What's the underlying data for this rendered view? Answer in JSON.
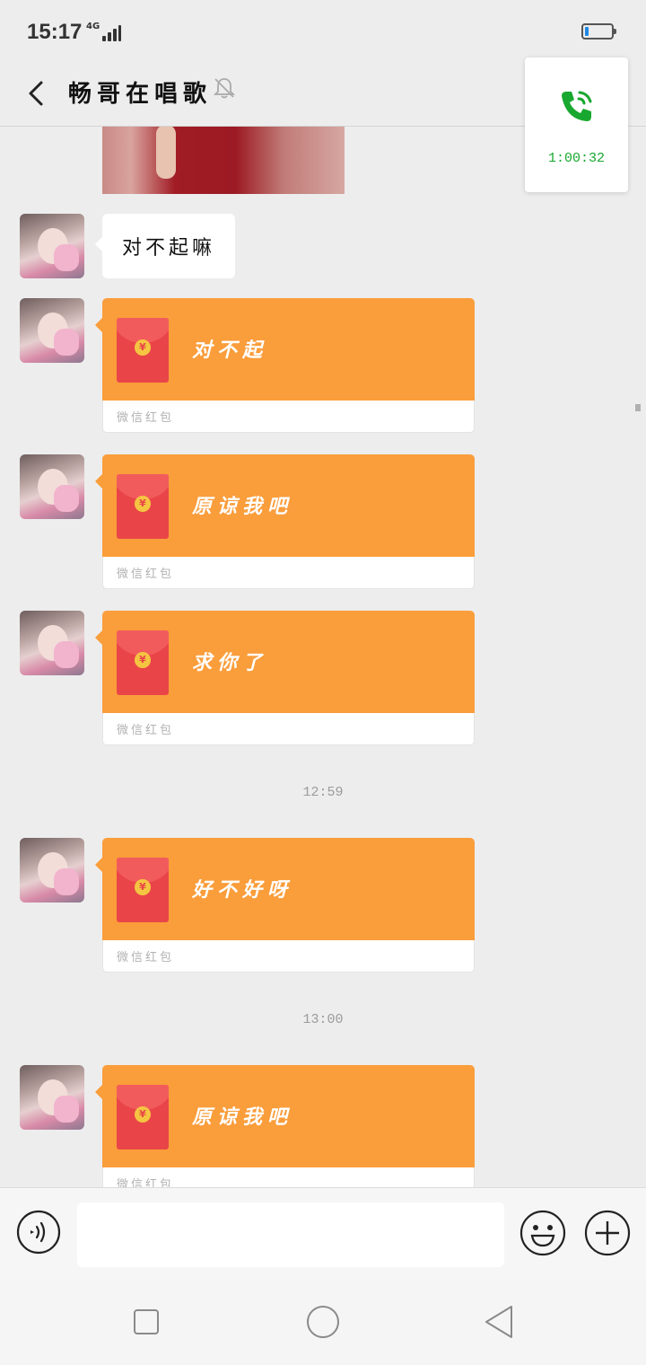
{
  "status": {
    "time": "15:17",
    "network": "4G"
  },
  "header": {
    "title": "畅哥在唱歌"
  },
  "call": {
    "duration": "1:00:32"
  },
  "messages": [
    {
      "type": "text",
      "text": "对不起嘛"
    },
    {
      "type": "red_packet",
      "text": "对不起",
      "label": "微信红包"
    },
    {
      "type": "red_packet",
      "text": "原谅我吧",
      "label": "微信红包"
    },
    {
      "type": "red_packet",
      "text": "求你了",
      "label": "微信红包"
    },
    {
      "type": "red_packet",
      "text": "好不好呀",
      "label": "微信红包"
    },
    {
      "type": "red_packet",
      "text": "原谅我吧",
      "label": "微信红包"
    }
  ],
  "timestamps": [
    "12:59",
    "13:00"
  ],
  "colors": {
    "red_packet": "#fa9d3b",
    "call_green": "#19a82f",
    "background": "#ededed"
  }
}
